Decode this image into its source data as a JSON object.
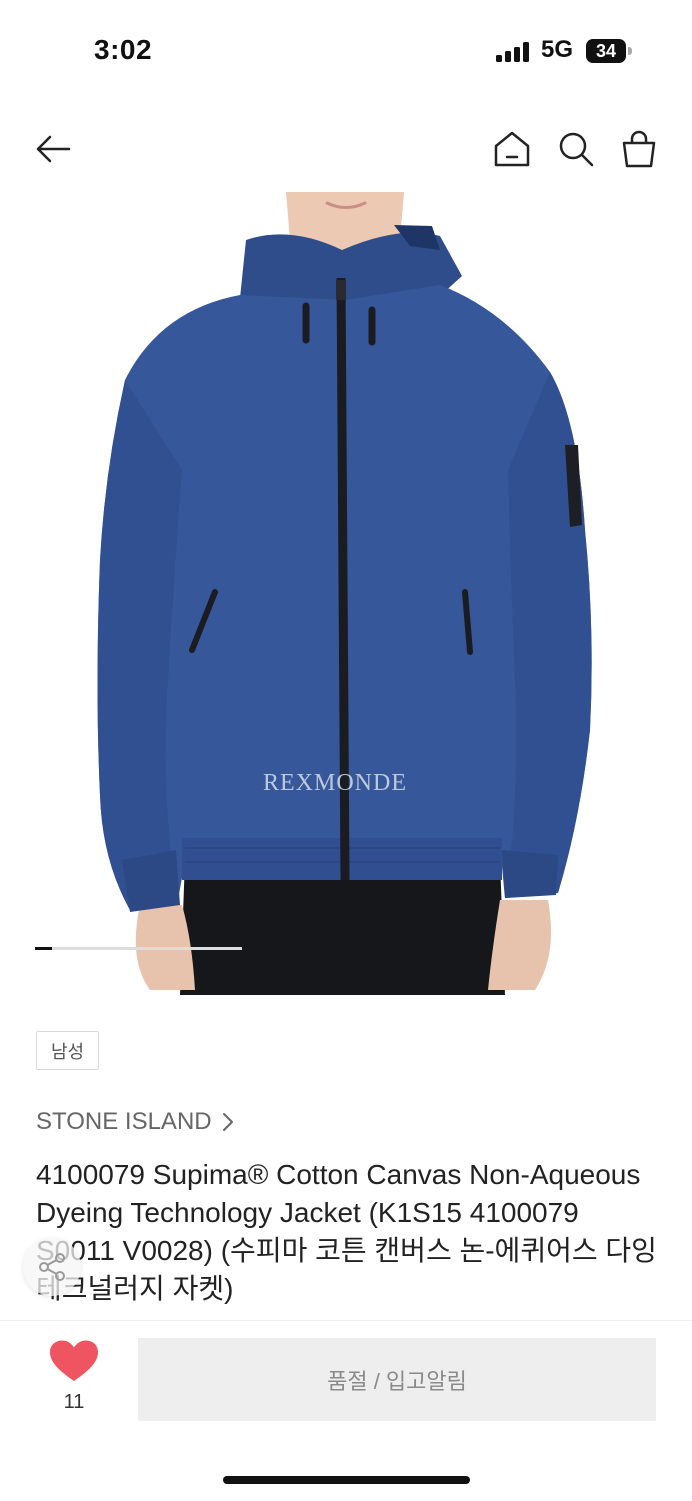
{
  "status": {
    "time": "3:02",
    "network": "5G",
    "battery": "34"
  },
  "product": {
    "watermark": "REXMONDE",
    "gallery_progress": 0.08,
    "tag": "남성",
    "brand": "STONE ISLAND",
    "title": "4100079 Supima® Cotton Canvas Non-Aqueous Dyeing Technology Jacket (K1S15 4100079 S0011 V0028) (수피마 코튼 캔버스 논-에퀴어스 다잉 테크널러지 자켓)"
  },
  "actions": {
    "like_count": "11",
    "soldout_label": "품절 / 입고알림"
  },
  "colors": {
    "jacket": "#36579a",
    "heart": "#ee5561",
    "button_bg": "#eeeeee"
  },
  "icons": [
    "back-arrow-icon",
    "home-icon",
    "search-icon",
    "shopping-bag-icon",
    "share-icon",
    "heart-icon"
  ]
}
